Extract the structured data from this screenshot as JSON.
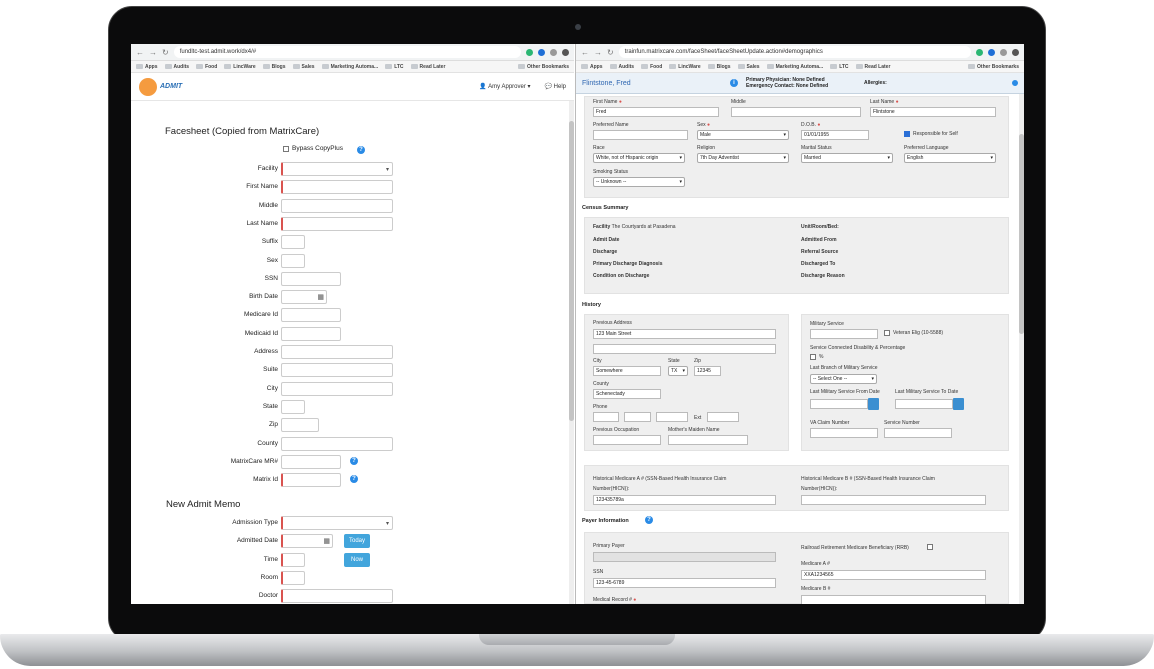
{
  "left": {
    "url": "fundltc-test.admit.work/dx4/#",
    "bookmarks": [
      "Apps",
      "Audits",
      "Food",
      "LincWare",
      "Blogs",
      "Sales",
      "Marketing Automa...",
      "LTC",
      "Read Later"
    ],
    "other_bookmarks": "Other Bookmarks",
    "logo_text": "ADMIT",
    "user": "Amy Approver ▾",
    "help": "Help",
    "facesheet_title": "Facesheet (Copied from MatrixCare)",
    "bypass_label": "Bypass CopyPlus",
    "fields": [
      "Facility",
      "First Name",
      "Middle",
      "Last Name",
      "Suffix",
      "Sex",
      "SSN",
      "Birth Date",
      "Medicare Id",
      "Medicaid Id",
      "Address",
      "Suite",
      "City",
      "State",
      "Zip",
      "County",
      "MatrixCare MR#",
      "Matrix Id"
    ],
    "memo_title": "New Admit Memo",
    "memo_fields": [
      "Admission Type",
      "Admitted Date",
      "Time",
      "Room",
      "Doctor"
    ],
    "today_btn": "Today",
    "now_btn": "Now"
  },
  "right": {
    "url": "trainfun.matrixcare.com/faceSheet/faceSheetUpdate.action#demographics",
    "bookmarks": [
      "Apps",
      "Audits",
      "Food",
      "LincWare",
      "Blogs",
      "Sales",
      "Marketing Automa...",
      "LTC",
      "Read Later"
    ],
    "other_bookmarks": "Other Bookmarks",
    "patient_name": "Flintstone, Fred",
    "primary_physician": "Primary Physician: None Defined",
    "emergency_contact": "Emergency Contact: None Defined",
    "allergies": "Allergies:",
    "first_name_label": "First Name",
    "first_name": "Fred",
    "middle_label": "Middle",
    "last_name_label": "Last Name",
    "last_name": "Flintstone",
    "preferred_name_label": "Preferred Name",
    "sex_label": "Sex",
    "sex": "Male",
    "dob_label": "D.O.B.",
    "dob": "01/01/1955",
    "responsible_label": "Responsible for Self",
    "race_label": "Race",
    "race": "White, not of Hispanic origin",
    "religion_label": "Religion",
    "religion": "7th Day Adventist",
    "marital_label": "Marital Status",
    "marital": "Married",
    "language_label": "Preferred Language",
    "language": "English",
    "smoking_label": "Smoking Status",
    "smoking": "-- Unknown --",
    "census_title": "Census Summary",
    "facility_label": "Facility",
    "facility": "The Courtyards at Pasadena",
    "admit_date": "Admit Date",
    "discharge": "Discharge",
    "primary_dx": "Primary Discharge Diagnosis",
    "condition": "Condition on Discharge",
    "unit_room": "Unit/Room/Bed:",
    "admitted_from": "Admitted From",
    "referral": "Referral Source",
    "discharged_to": "Discharged To",
    "discharge_reason": "Discharge Reason",
    "history_title": "History",
    "prev_address_label": "Previous Address",
    "prev_address": "123 Main Street",
    "city_label": "City",
    "city": "Somewhere",
    "state_label": "State",
    "state": "TX",
    "zip_label": "Zip",
    "zip": "12345",
    "county_label": "County",
    "county": "Schenectady",
    "phone_label": "Phone",
    "ext_label": "Ext",
    "prev_occ_label": "Previous Occupation",
    "maiden_label": "Mother's Maiden Name",
    "military_label": "Military Service",
    "veteran_label": "Veteran Elig (10-5588)",
    "service_connected": "Service Connected Disability & Percentage",
    "pct": "%",
    "last_branch": "Last Branch of Military Service",
    "select_one": "-- Select One --",
    "from_date": "Last Military Service From Date",
    "to_date": "Last Military Service To Date",
    "va_claim": "VA Claim Number",
    "service_number": "Service Number",
    "hist_medicare_a": "Historical Medicare A # (SSN-Based Health Insurance Claim",
    "hist_medicare_b": "Historical Medicare B # (SSN-Based Health Insurance Claim",
    "number_hicn": "Number(HICN)):",
    "hicn_a": "123435789a",
    "payer_title": "Payer Information",
    "primary_payer": "Primary Payer",
    "rrb": "Railroad Retirement Medicare Beneficiary (RRB)",
    "ssn_label": "SSN",
    "ssn": "123-45-6789",
    "medicare_a": "Medicare A #",
    "medicare_a_val": "XXA1234565",
    "medicare_b": "Medicare B #",
    "medical_record": "Medical Record #"
  }
}
